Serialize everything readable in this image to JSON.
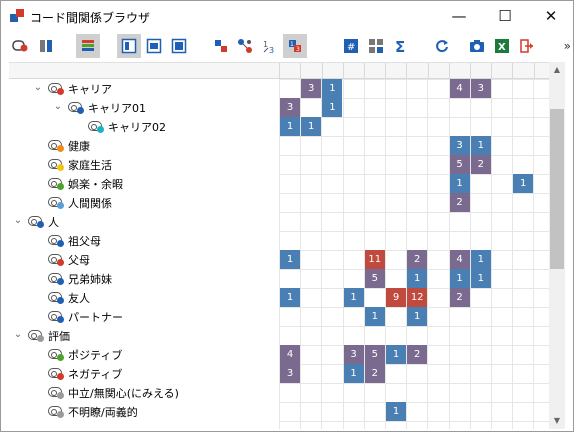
{
  "window": {
    "title": "コード間関係ブラウザ",
    "controls": {
      "minimize": "—",
      "maximize": "☐",
      "close": "✕"
    }
  },
  "toolbar": {
    "overflow": "»",
    "buttons": [
      {
        "name": "code-settings-icon",
        "active": false
      },
      {
        "name": "columns-icon",
        "active": false
      },
      {
        "name": "colors-icon",
        "active": true
      },
      {
        "name": "layout1-icon",
        "active": true
      },
      {
        "name": "layout2-icon",
        "active": false
      },
      {
        "name": "layout3-icon",
        "active": false
      },
      {
        "name": "squares-icon",
        "active": false
      },
      {
        "name": "nodes-icon",
        "active": false
      },
      {
        "name": "sort-icon",
        "active": false
      },
      {
        "name": "numbers-icon",
        "active": true
      },
      {
        "name": "hash-icon",
        "active": false
      },
      {
        "name": "table-numbers-icon",
        "active": false
      },
      {
        "name": "sum-icon",
        "active": false
      },
      {
        "name": "refresh-icon",
        "active": false
      },
      {
        "name": "camera-icon",
        "active": false
      },
      {
        "name": "excel-icon",
        "active": false
      },
      {
        "name": "exit-icon",
        "active": false
      }
    ]
  },
  "colors": {
    "blue": "#4a7fb3",
    "purple": "#7a6a8f",
    "red": "#c04a3e",
    "dot_red": "#d23a2a",
    "dot_blue": "#1f5fb4",
    "dot_cyan": "#19b3c9",
    "dot_orange": "#f08a1c",
    "dot_yellow": "#f2c514",
    "dot_green": "#4aa32a",
    "dot_lightblue": "#5aa0d8",
    "dot_gray": "#9a9a9a"
  },
  "tree": [
    {
      "label": "キャリア",
      "level": 2,
      "expanded": true,
      "dot": "dot_red"
    },
    {
      "label": "キャリア01",
      "level": 3,
      "expanded": true,
      "dot": "dot_blue"
    },
    {
      "label": "キャリア02",
      "level": 4,
      "dot": "dot_cyan"
    },
    {
      "label": "健康",
      "level": 2,
      "dot": "dot_orange"
    },
    {
      "label": "家庭生活",
      "level": 2,
      "dot": "dot_yellow"
    },
    {
      "label": "娯楽・余暇",
      "level": 2,
      "dot": "dot_green"
    },
    {
      "label": "人間関係",
      "level": 2,
      "dot": "dot_lightblue"
    },
    {
      "label": "人",
      "level": 1,
      "expanded": true,
      "dot": "dot_blue"
    },
    {
      "label": "祖父母",
      "level": 2,
      "dot": "dot_blue"
    },
    {
      "label": "父母",
      "level": 2,
      "dot": "dot_red"
    },
    {
      "label": "兄弟姉妹",
      "level": 2,
      "dot": "dot_blue"
    },
    {
      "label": "友人",
      "level": 2,
      "dot": "dot_blue"
    },
    {
      "label": "パートナー",
      "level": 2,
      "dot": "dot_blue"
    },
    {
      "label": "評価",
      "level": 1,
      "expanded": true,
      "dot": "dot_gray"
    },
    {
      "label": "ポジティブ",
      "level": 2,
      "dot": "dot_green"
    },
    {
      "label": "ネガティブ",
      "level": 2,
      "dot": "dot_red"
    },
    {
      "label": "中立/無関心(にみえる)",
      "level": 2,
      "dot": "dot_gray"
    },
    {
      "label": "不明瞭/両義的",
      "level": 2,
      "dot": "dot_gray"
    }
  ],
  "matrix": [
    [
      {
        "c": 1,
        "v": "3",
        "k": "purple"
      },
      {
        "c": 2,
        "v": "1",
        "k": "blue"
      },
      {
        "c": 8,
        "v": "4",
        "k": "purple"
      },
      {
        "c": 9,
        "v": "3",
        "k": "purple"
      }
    ],
    [
      {
        "c": 0,
        "v": "3",
        "k": "purple"
      },
      {
        "c": 2,
        "v": "1",
        "k": "blue"
      }
    ],
    [
      {
        "c": 0,
        "v": "1",
        "k": "blue"
      },
      {
        "c": 1,
        "v": "1",
        "k": "blue"
      }
    ],
    [
      {
        "c": 8,
        "v": "3",
        "k": "blue"
      },
      {
        "c": 9,
        "v": "1",
        "k": "blue"
      }
    ],
    [
      {
        "c": 8,
        "v": "5",
        "k": "purple"
      },
      {
        "c": 9,
        "v": "2",
        "k": "purple"
      }
    ],
    [
      {
        "c": 8,
        "v": "1",
        "k": "blue"
      },
      {
        "c": 11,
        "v": "1",
        "k": "blue"
      }
    ],
    [
      {
        "c": 8,
        "v": "2",
        "k": "purple"
      }
    ],
    [],
    [],
    [
      {
        "c": 0,
        "v": "1",
        "k": "blue"
      },
      {
        "c": 4,
        "v": "11",
        "k": "red"
      },
      {
        "c": 6,
        "v": "2",
        "k": "purple"
      },
      {
        "c": 8,
        "v": "4",
        "k": "purple"
      },
      {
        "c": 9,
        "v": "1",
        "k": "blue"
      }
    ],
    [
      {
        "c": 4,
        "v": "5",
        "k": "purple"
      },
      {
        "c": 6,
        "v": "1",
        "k": "blue"
      },
      {
        "c": 8,
        "v": "1",
        "k": "blue"
      },
      {
        "c": 9,
        "v": "1",
        "k": "blue"
      }
    ],
    [
      {
        "c": 0,
        "v": "1",
        "k": "blue"
      },
      {
        "c": 3,
        "v": "1",
        "k": "blue"
      },
      {
        "c": 5,
        "v": "9",
        "k": "red"
      },
      {
        "c": 6,
        "v": "12",
        "k": "red"
      },
      {
        "c": 8,
        "v": "2",
        "k": "purple"
      }
    ],
    [
      {
        "c": 4,
        "v": "1",
        "k": "blue"
      },
      {
        "c": 6,
        "v": "1",
        "k": "blue"
      }
    ],
    [],
    [
      {
        "c": 0,
        "v": "4",
        "k": "purple"
      },
      {
        "c": 3,
        "v": "3",
        "k": "purple"
      },
      {
        "c": 4,
        "v": "5",
        "k": "purple"
      },
      {
        "c": 5,
        "v": "1",
        "k": "blue"
      },
      {
        "c": 6,
        "v": "2",
        "k": "purple"
      }
    ],
    [
      {
        "c": 0,
        "v": "3",
        "k": "purple"
      },
      {
        "c": 3,
        "v": "1",
        "k": "blue"
      },
      {
        "c": 4,
        "v": "2",
        "k": "purple"
      }
    ],
    [],
    [
      {
        "c": 5,
        "v": "1",
        "k": "blue"
      }
    ]
  ]
}
